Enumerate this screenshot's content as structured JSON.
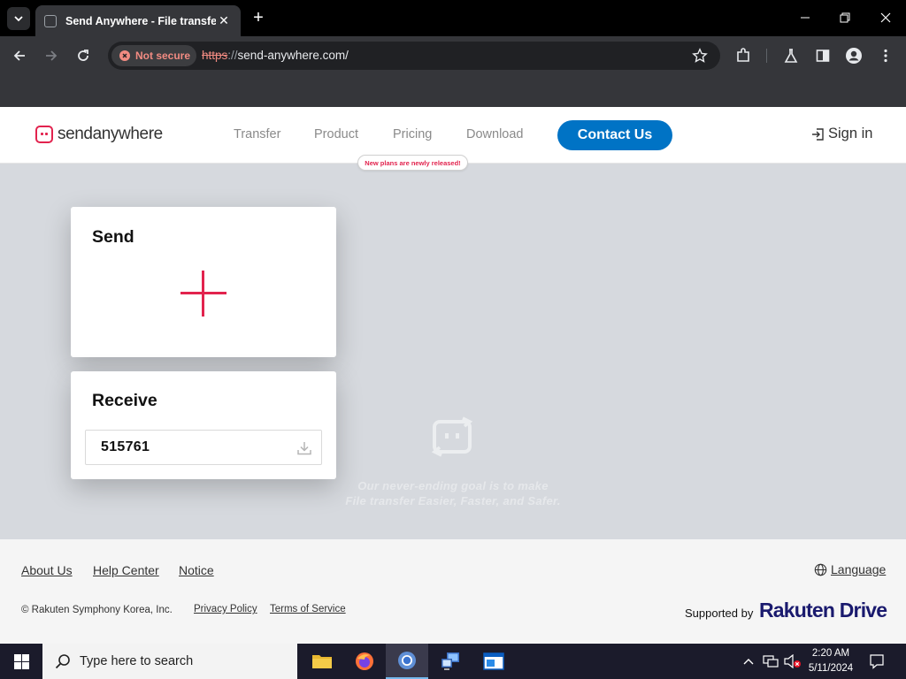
{
  "browser": {
    "tab_title": "Send Anywhere - File transfer",
    "tab_close": "✕",
    "new_tab": "+",
    "security_label": "Not secure",
    "url_scheme": "https",
    "url_sep": "://",
    "url_host": "send-anywhere.com/"
  },
  "site": {
    "logo_text": "sendanywhere",
    "nav": [
      "Transfer",
      "Product",
      "Pricing",
      "Download"
    ],
    "pricing_badge": "New plans are newly released!",
    "contact_label": "Contact Us",
    "signin_label": "Sign in",
    "accent_color": "#e2234e",
    "brand_blue": "#0073c5"
  },
  "send_card": {
    "title": "Send"
  },
  "receive_card": {
    "title": "Receive",
    "key_value": "515761"
  },
  "hero": {
    "line1": "Our never-ending goal is to make",
    "line2": "File transfer Easier, Faster, and Safer."
  },
  "footer": {
    "links": [
      "About Us",
      "Help Center",
      "Notice"
    ],
    "language_label": "Language",
    "copyright": "© Rakuten Symphony Korea, Inc.",
    "privacy": "Privacy Policy",
    "terms": "Terms of Service",
    "supported_by": "Supported by",
    "rakuten": "Rakuten",
    "drive": "Drive"
  },
  "taskbar": {
    "search_placeholder": "Type here to search",
    "time": "2:20 AM",
    "date": "5/11/2024"
  }
}
